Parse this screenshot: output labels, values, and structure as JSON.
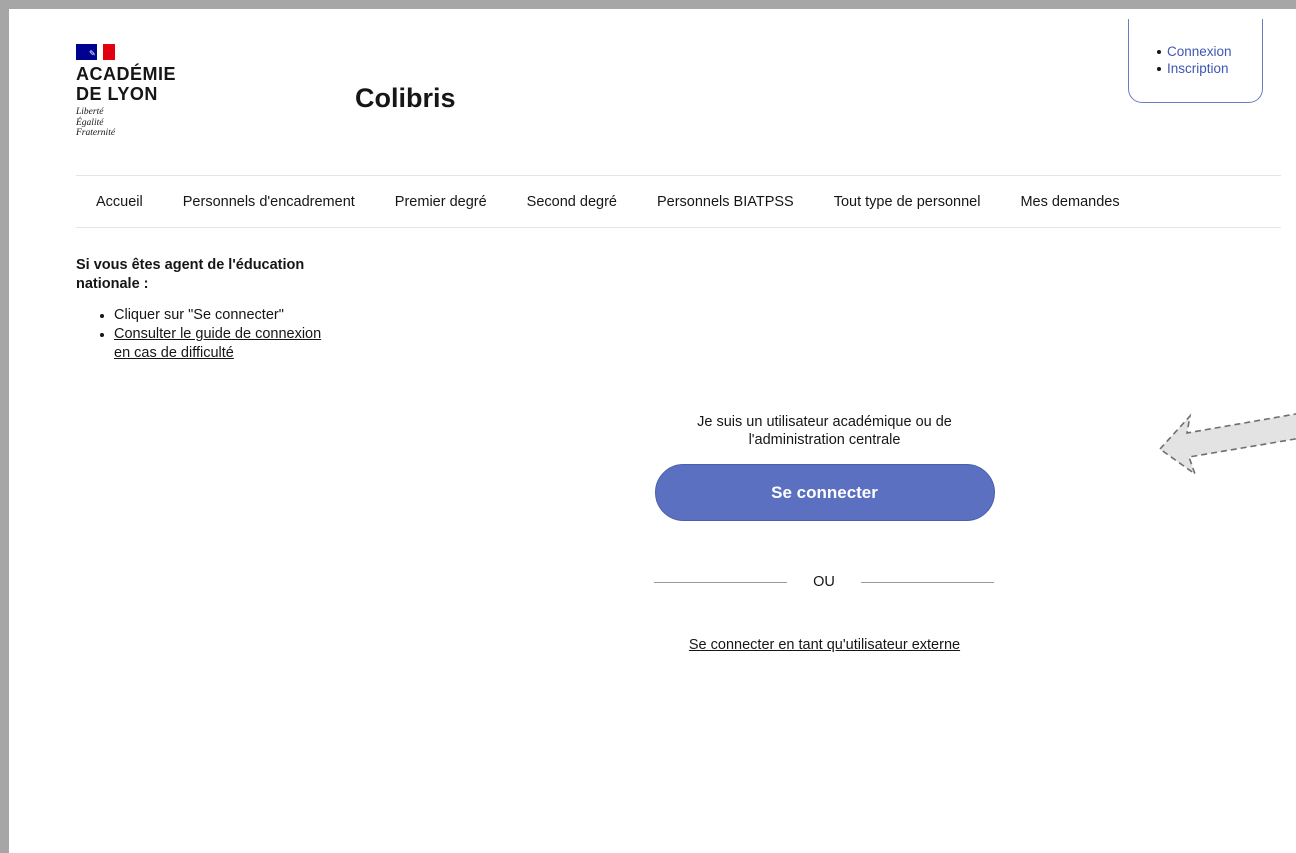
{
  "header": {
    "institution_line1": "ACADÉMIE",
    "institution_line2": "DE LYON",
    "motto": [
      "Liberté",
      "Égalité",
      "Fraternité"
    ],
    "site_title": "Colibris"
  },
  "account_menu": {
    "items": [
      {
        "label": "Connexion"
      },
      {
        "label": "Inscription"
      }
    ],
    "link_color": "#3f56b5"
  },
  "nav": {
    "items": [
      {
        "label": "Accueil"
      },
      {
        "label": "Personnels d'encadrement"
      },
      {
        "label": "Premier degré"
      },
      {
        "label": "Second degré"
      },
      {
        "label": "Personnels BIATPSS"
      },
      {
        "label": "Tout type de personnel"
      },
      {
        "label": "Mes demandes"
      }
    ]
  },
  "info": {
    "heading": "Si vous êtes agent de l'éducation nationale :",
    "bullets": [
      {
        "text": "Cliquer sur \"Se connecter\"",
        "is_link": false
      },
      {
        "text": "Consulter le guide de connexion en cas de difficulté",
        "is_link": true
      }
    ]
  },
  "login": {
    "intro": "Je suis un utilisateur académique ou de l'administration centrale",
    "connect_button": "Se connecter",
    "separator": "OU",
    "external_link": "Se connecter en tant qu'utilisateur externe",
    "button_color": "#5b70c0"
  },
  "icons": {
    "arrow": "dashed-arrow-left-icon",
    "flag": "french-flag-icon"
  }
}
